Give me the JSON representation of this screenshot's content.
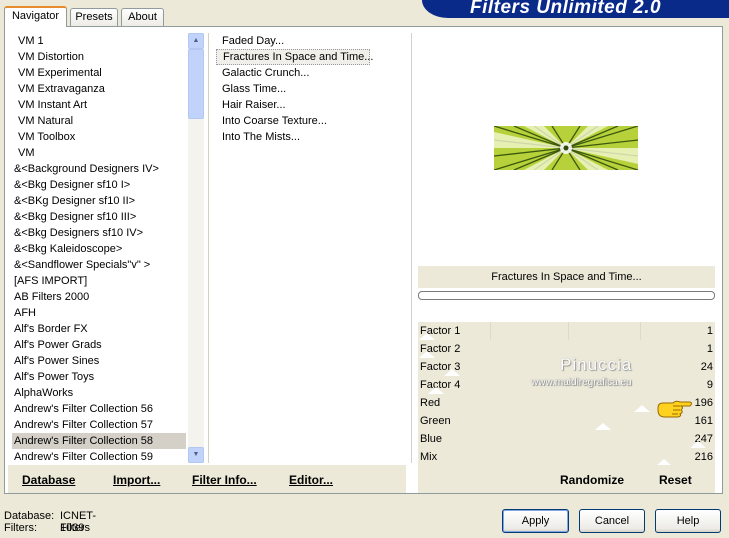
{
  "tabs": [
    {
      "label": "Navigator"
    },
    {
      "label": "Presets"
    },
    {
      "label": "About"
    }
  ],
  "banner": {
    "title": "Filters Unlimited 2.0",
    "color": "#0A2A8A"
  },
  "categories": [
    "VM 1",
    "VM Distortion",
    "VM Experimental",
    "VM Extravaganza",
    "VM Instant Art",
    "VM Natural",
    "VM Toolbox",
    "VM",
    "&<Background Designers IV>",
    "&<Bkg Designer sf10 I>",
    "&<BKg Designer sf10 II>",
    "&<Bkg Designer sf10 III>",
    "&<Bkg Designers sf10 IV>",
    "&<Bkg Kaleidoscope>",
    "&<Sandflower Specials\"v\" >",
    "[AFS IMPORT]",
    "AB Filters 2000",
    "AFH",
    "Alf's Border FX",
    "Alf's Power Grads",
    "Alf's Power Sines",
    "Alf's Power Toys",
    "AlphaWorks",
    "Andrew's Filter Collection 56",
    "Andrew's Filter Collection 57",
    "Andrew's Filter Collection 58",
    "Andrew's Filter Collection 59"
  ],
  "selected_category": "Andrew's Filter Collection 58",
  "filters": [
    "Faded Day...",
    "Fractures In Space and Time...",
    "Galactic Crunch...",
    "Glass Time...",
    "Hair Raiser...",
    "Into Coarse Texture...",
    "Into The Mists..."
  ],
  "selected_filter": "Fractures In Space and Time...",
  "preview": {
    "filter_name": "Fractures In Space and Time...",
    "progress_percent": 0
  },
  "params": [
    {
      "label": "Factor 1",
      "value": "1"
    },
    {
      "label": "Factor 2",
      "value": "1"
    },
    {
      "label": "Factor 3",
      "value": "24"
    },
    {
      "label": "Factor 4",
      "value": "9"
    },
    {
      "label": "Red",
      "value": "196"
    },
    {
      "label": "Green",
      "value": "161"
    },
    {
      "label": "Blue",
      "value": "247"
    },
    {
      "label": "Mix",
      "value": "216"
    }
  ],
  "watermark": {
    "name": "Pinuccia",
    "site": "www.maidiregrafica.eu"
  },
  "left_links": {
    "database": "Database",
    "import": "Import...",
    "filter_info": "Filter Info...",
    "editor": "Editor..."
  },
  "right_links": {
    "randomize": "Randomize",
    "reset": "Reset"
  },
  "status": {
    "db_label": "Database:",
    "db_value": "ICNET-Filters",
    "filters_label": "Filters:",
    "filters_value": "1039"
  },
  "buttons": {
    "apply": "Apply",
    "cancel": "Cancel",
    "help": "Help"
  }
}
